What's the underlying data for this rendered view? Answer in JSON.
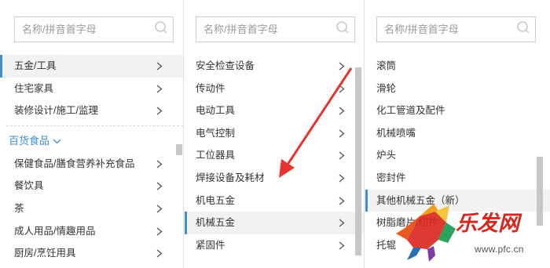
{
  "colors": {
    "accent": "#3d8fd6",
    "active_bg": "#f2f2f2",
    "arrow": "#e8332f",
    "logo_red": "#d9261c"
  },
  "col1": {
    "search_placeholder": "名称/拼音首字母",
    "items_top": [
      {
        "label": "五金/工具",
        "active": true
      },
      {
        "label": "住宅家具"
      },
      {
        "label": "装修设计/施工/监理"
      }
    ],
    "group_label": "百货食品",
    "items_bottom": [
      {
        "label": "保健食品/膳食营养补充食品"
      },
      {
        "label": "餐饮具"
      },
      {
        "label": "茶"
      },
      {
        "label": "成人用品/情趣用品"
      },
      {
        "label": "厨房/烹饪用具"
      }
    ]
  },
  "col2": {
    "search_placeholder": "名称/拼音首字母",
    "items": [
      {
        "label": "安全检查设备"
      },
      {
        "label": "传动件"
      },
      {
        "label": "电动工具"
      },
      {
        "label": "电气控制"
      },
      {
        "label": "工位器具"
      },
      {
        "label": "焊接设备及耗材"
      },
      {
        "label": "机电五金"
      },
      {
        "label": "机械五金",
        "active": true
      },
      {
        "label": "紧固件"
      }
    ]
  },
  "col3": {
    "search_placeholder": "名称/拼音首字母",
    "items": [
      {
        "label": "滚筒"
      },
      {
        "label": "滑轮"
      },
      {
        "label": "化工管道及配件"
      },
      {
        "label": "机械喷嘴"
      },
      {
        "label": "炉头"
      },
      {
        "label": "密封件"
      },
      {
        "label": "其他机械五金（新）",
        "active": true
      },
      {
        "label": "树脂磨片/切片"
      },
      {
        "label": "托辊"
      }
    ]
  },
  "watermark": {
    "brand": "乐发网",
    "url": "www.pfc.cn"
  }
}
